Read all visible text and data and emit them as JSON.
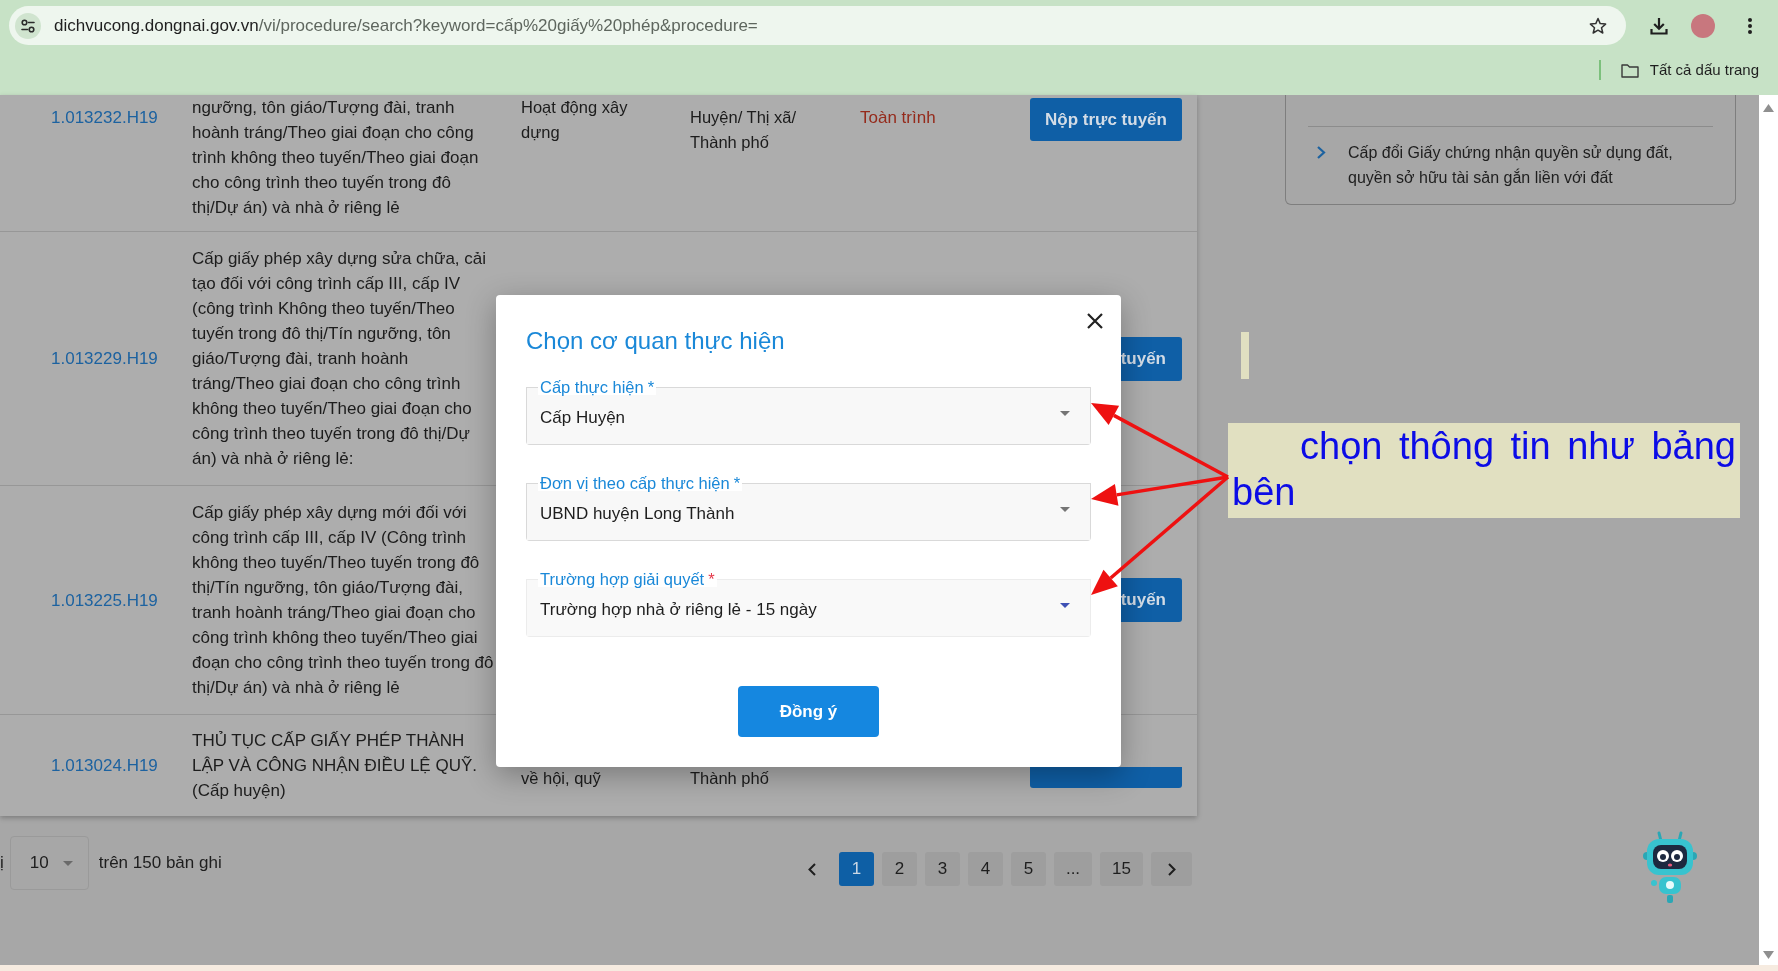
{
  "browser": {
    "url_host": "dichvucong.dongnai.gov.vn",
    "url_rest": "/vi/procedure/search?keyword=cấp%20giấy%20phép&procedure=",
    "bookmarks_label": "Tất cả dấu trang"
  },
  "table": {
    "rows": [
      {
        "column_1": "1.013232.H19",
        "column_2": "ngưỡng, tôn giáo/Tượng đài, tranh hoành tráng/Theo giai đoạn cho công trình không theo tuyến/Theo giai đoạn cho công trình theo tuyến trong đô thị/Dự án) và nhà ở riêng lẻ",
        "column_3": "Hoạt động xây dựng",
        "column_4": "Huyện/ Thị xã/ Thành phố",
        "column_5": "Toàn trình",
        "column_6": {
          "kind": "full",
          "label": "Nộp trực tuyến"
        }
      },
      {
        "column_1": "1.013229.H19",
        "column_2": "Cấp giấy phép xây dựng sửa chữa, cải tạo đối với công trình cấp III, cấp IV (công trình Không theo tuyến/Theo tuyến trong đô thị/Tín ngưỡng, tôn giáo/Tượng đài, tranh hoành tráng/Theo giai đoạn cho công trình không theo tuyến/Theo giai đoạn cho công trình theo tuyến trong đô thị/Dự án) và nhà ở riêng lẻ:",
        "column_6": {
          "kind": "right_part",
          "label": "tuyến"
        }
      },
      {
        "column_1": "1.013225.H19",
        "column_2": "Cấp giấy phép xây dựng mới đối với công trình cấp III, cấp IV (Công trình không theo tuyến/Theo tuyến trong đô thị/Tín ngưỡng, tôn giáo/Tượng đài, tranh hoành tráng/Theo giai đoạn cho công trình không theo tuyến/Theo giai đoạn cho công trình theo tuyến trong đô thị/Dự án) và nhà ở riêng lẻ",
        "column_6": {
          "kind": "right_part",
          "label": "tuyến"
        }
      },
      {
        "column_1": "1.013024.H19",
        "column_2": "THỦ TỤC CẤP GIẤY PHÉP THÀNH LẬP VÀ CÔNG NHẬN ĐIỀU LỆ QUỸ. (Cấp huyện)",
        "column_3": "về hội, quỹ",
        "column_4": "Thành phố",
        "column_6": {
          "kind": "bottom_part"
        }
      }
    ]
  },
  "side_panel": {
    "items": [
      {
        "text": "Cấp đổi Giấy chứng nhận quyền sử dụng đất, quyền sở hữu tài sản gắn liền với đất"
      }
    ]
  },
  "pagination": {
    "label_tail": "ị",
    "page_size": "10",
    "total": "trên 150 bản ghi",
    "pages": [
      {
        "label": "1",
        "selected": true
      },
      {
        "label": "2",
        "selected": false
      },
      {
        "label": "3",
        "selected": false
      },
      {
        "label": "4",
        "selected": false
      },
      {
        "label": "5",
        "selected": false
      },
      {
        "label": "...",
        "selected": false
      },
      {
        "label": "15",
        "selected": false
      }
    ]
  },
  "dialog": {
    "title": "Chọn cơ quan thực hiện",
    "fields": [
      {
        "label": "Cấp thực hiện",
        "required_mark": "*",
        "value": "Cấp Huyện",
        "focused": false,
        "pointed_by_arrow": true
      },
      {
        "label": "Đơn vị theo cấp thực hiện",
        "required_mark": "*",
        "value": "UBND huyện Long Thành",
        "focused": false,
        "pointed_by_arrow": true
      },
      {
        "label": "Trường hợp giải quyết",
        "required_mark": "*",
        "value": "Trường hợp nhà ở riêng lẻ - 15 ngày",
        "focused": true,
        "pointed_by_arrow": true
      }
    ],
    "confirm_button": "Đồng ý"
  },
  "annotation": {
    "text": "chọn thông tin như bảng bên"
  }
}
